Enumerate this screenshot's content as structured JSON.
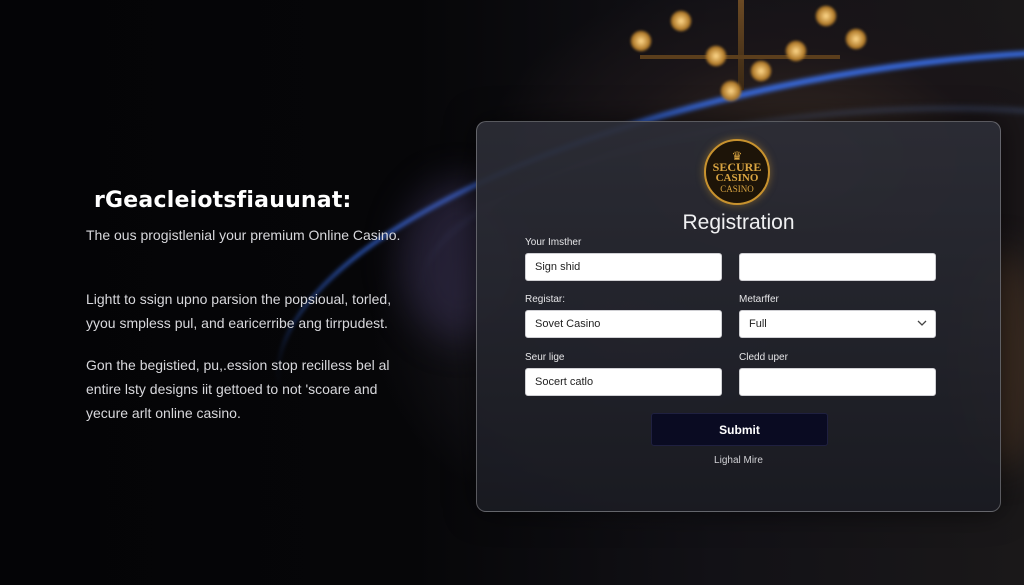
{
  "left": {
    "headline": "rGeacleiotsfiauunat:",
    "subline": "The ous progistlenial your premium Online Casino.",
    "para1_line1": "Lightt to ssign upno parsion the popsioual, torled,",
    "para1_line2": "yyou smpless pul, and earicerribe ang tirrpudest.",
    "para2_line1": "Gon the begistied, pu,.ession stop recilless bel al",
    "para2_line2": "entire lsty designs iit gettoed to not 'scoare and",
    "para2_line3": "yecure arlt online casino."
  },
  "logo": {
    "line1": "SECURE",
    "line2": "CASINO",
    "line3": "CASINO",
    "crown": "♛"
  },
  "form": {
    "title": "Registration",
    "fields": [
      {
        "label": "Your Imsther",
        "value": "Sign shid"
      },
      {
        "label": "",
        "value": ""
      },
      {
        "label": "Registar:",
        "value": "Sovet Casino"
      },
      {
        "label": "Metarffer",
        "value": "Full"
      },
      {
        "label": "Seur lige",
        "value": "Socert catlo"
      },
      {
        "label": "Cledd uper",
        "value": ""
      }
    ],
    "submit_label": "Submit",
    "footer_link": "Lighal Mire"
  },
  "colors": {
    "accent_blue": "#3c78ff",
    "gold": "#c8922e",
    "button": "#0a0b22"
  }
}
